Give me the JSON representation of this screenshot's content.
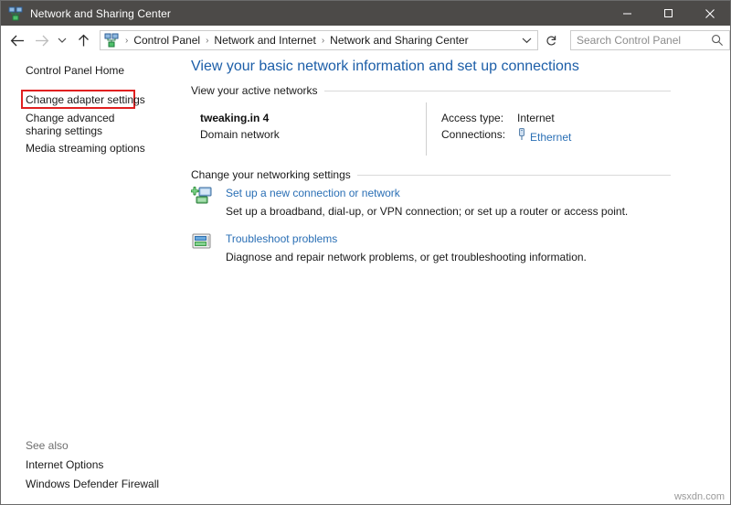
{
  "window": {
    "title": "Network and Sharing Center",
    "icon": "network-sharing-icon",
    "controls": {
      "minimize": "minimize-icon",
      "maximize": "maximize-icon",
      "close": "close-icon"
    }
  },
  "nav": {
    "back": "back-arrow-icon",
    "forward": "forward-arrow-icon",
    "recent": "chevron-down-icon",
    "up": "up-arrow-icon",
    "refresh": "refresh-icon",
    "address_chevron": "chevron-down-icon",
    "breadcrumb": [
      "Control Panel",
      "Network and Internet",
      "Network and Sharing Center"
    ],
    "separator": "›"
  },
  "search": {
    "placeholder": "Search Control Panel",
    "value": "",
    "icon": "search-icon"
  },
  "sidebar": {
    "links": [
      {
        "label": "Control Panel Home"
      },
      {
        "label": "Change adapter settings",
        "highlighted": true
      },
      {
        "label": "Change advanced sharing settings"
      },
      {
        "label": "Media streaming options"
      }
    ],
    "see_also_label": "See also",
    "see_also": [
      {
        "label": "Internet Options"
      },
      {
        "label": "Windows Defender Firewall"
      }
    ]
  },
  "main": {
    "page_title": "View your basic network information and set up connections",
    "sections": {
      "active_networks_heading": "View your active networks",
      "change_settings_heading": "Change your networking settings"
    },
    "active_network": {
      "name": "tweaking.in 4",
      "type": "Domain network",
      "access_type_label": "Access type:",
      "access_type_value": "Internet",
      "connections_label": "Connections:",
      "connections_value": "Ethernet",
      "connections_icon": "ethernet-plug-icon"
    },
    "tasks": [
      {
        "link": "Set up a new connection or network",
        "description": "Set up a broadband, dial-up, or VPN connection; or set up a router or access point.",
        "icon": "new-connection-icon"
      },
      {
        "link": "Troubleshoot problems",
        "description": "Diagnose and repair network problems, or get troubleshooting information.",
        "icon": "troubleshoot-icon"
      }
    ]
  },
  "watermark": "wsxdn.com",
  "colors": {
    "titlebar": "#4c4a48",
    "heading_blue": "#1c5ea8",
    "link_blue": "#2a6fb5",
    "highlight_red": "#e02020"
  }
}
